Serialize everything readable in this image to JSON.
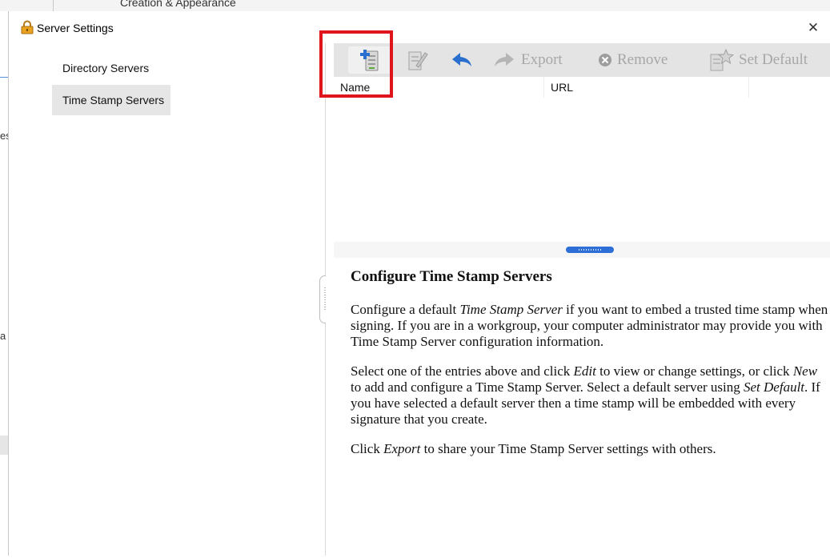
{
  "background_window": {
    "title_fragment": "Creation & Appearance",
    "left_fragments": [
      "es",
      "a"
    ]
  },
  "dialog": {
    "title": "Server Settings",
    "close_glyph": "✕"
  },
  "nav": {
    "items": [
      {
        "label": "Directory Servers",
        "selected": false
      },
      {
        "label": "Time Stamp Servers",
        "selected": true
      }
    ]
  },
  "toolbar": {
    "new_icon": "new-server-icon",
    "edit_icon": "edit-icon",
    "import_icon": "import-arrow-icon",
    "export_label": "Export",
    "remove_label": "Remove",
    "set_default_label": "Set Default"
  },
  "grid": {
    "columns": [
      "Name",
      "URL"
    ],
    "rows": []
  },
  "help": {
    "heading": "Configure Time Stamp Servers",
    "p1": [
      "Configure a default ",
      "Time Stamp Server",
      " if you want to embed a trusted time stamp when signing. If you are in a workgroup, your computer administrator may provide you with Time Stamp Server configuration information."
    ],
    "p2": [
      "Select one of the entries above and click ",
      "Edit",
      " to view or change settings, or click ",
      "New",
      " to add and configure a Time Stamp Server. Select a default server using ",
      "Set Default",
      ". If you have selected a default server then a time stamp will be embedded with every signature that you create."
    ],
    "p3": [
      "Click ",
      "Export",
      " to share your Time Stamp Server settings with others."
    ]
  },
  "colors": {
    "highlight": "#e0141c",
    "splitter_accent": "#2d6fd6",
    "toolbar_bg": "#e4e4e4",
    "disabled_text": "#a7a7a7"
  }
}
